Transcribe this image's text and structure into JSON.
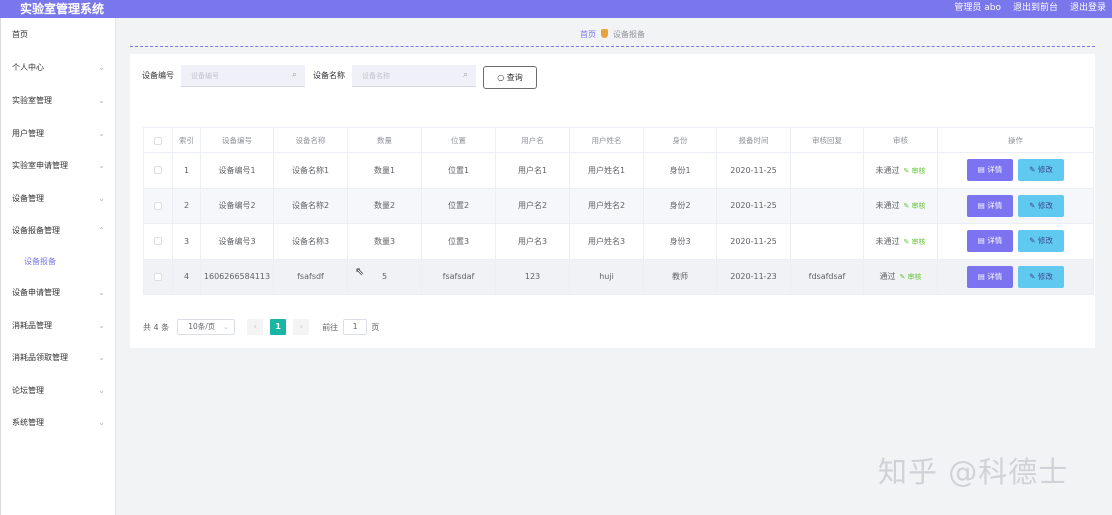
{
  "header": {
    "title": "实验室管理系统",
    "admin_label": "管理员 abo",
    "back_label": "退出到前台",
    "logout_label": "退出登录"
  },
  "sidebar": {
    "items": [
      {
        "label": "首页",
        "has_chevron": false
      },
      {
        "label": "个人中心",
        "has_chevron": true
      },
      {
        "label": "实验室管理",
        "has_chevron": true
      },
      {
        "label": "用户管理",
        "has_chevron": true
      },
      {
        "label": "实验室申请管理",
        "has_chevron": true
      },
      {
        "label": "设备管理",
        "has_chevron": true
      },
      {
        "label": "设备报备管理",
        "has_chevron": true,
        "expanded": true
      },
      {
        "label": "设备申请管理",
        "has_chevron": true
      },
      {
        "label": "消耗品管理",
        "has_chevron": true
      },
      {
        "label": "消耗品领取管理",
        "has_chevron": true
      },
      {
        "label": "论坛管理",
        "has_chevron": true
      },
      {
        "label": "系统管理",
        "has_chevron": true
      }
    ],
    "sub_item": "设备报备",
    "chevron_icon": "chevron-down-icon"
  },
  "breadcrumb": {
    "home": "首页",
    "current": "设备报备"
  },
  "search": {
    "code_label": "设备编号",
    "code_placeholder": "设备编号",
    "name_label": "设备名称",
    "name_placeholder": "设备名称",
    "query_label": "查询"
  },
  "table": {
    "headers": [
      "",
      "索引",
      "设备编号",
      "设备名称",
      "数量",
      "位置",
      "用户名",
      "用户姓名",
      "身份",
      "报备时间",
      "审核回复",
      "审核",
      "操作"
    ],
    "rows": [
      {
        "index": "1",
        "code": "设备编号1",
        "name": "设备名称1",
        "qty": "数量1",
        "location": "位置1",
        "username": "用户名1",
        "realname": "用户姓名1",
        "identity": "身份1",
        "time": "2020-11-25",
        "reply": "",
        "status": "未通过",
        "review": "审核"
      },
      {
        "index": "2",
        "code": "设备编号2",
        "name": "设备名称2",
        "qty": "数量2",
        "location": "位置2",
        "username": "用户名2",
        "realname": "用户姓名2",
        "identity": "身份2",
        "time": "2020-11-25",
        "reply": "",
        "status": "未通过",
        "review": "审核"
      },
      {
        "index": "3",
        "code": "设备编号3",
        "name": "设备名称3",
        "qty": "数量3",
        "location": "位置3",
        "username": "用户名3",
        "realname": "用户姓名3",
        "identity": "身份3",
        "time": "2020-11-25",
        "reply": "",
        "status": "未通过",
        "review": "审核"
      },
      {
        "index": "4",
        "code": "1606266584113",
        "name": "fsafsdf",
        "qty": "5",
        "location": "fsafsdaf",
        "username": "123",
        "realname": "huji",
        "identity": "教师",
        "time": "2020-11-23",
        "reply": "fdsafdsaf",
        "status": "通过",
        "review": "审核"
      }
    ],
    "detail_label": "详情",
    "edit_label": "修改"
  },
  "pagination": {
    "total": "共 4 条",
    "page_size": "10条/页",
    "prev": "‹",
    "current_page": "1",
    "next": "›",
    "goto_label": "前往",
    "goto_value": "1",
    "page_unit": "页"
  },
  "watermark": "知乎 @科德士",
  "colors": {
    "accent": "#7a76ec",
    "detail_button": "#7b73f0",
    "edit_button": "#60c9f0",
    "active_page": "#19b7a3"
  }
}
